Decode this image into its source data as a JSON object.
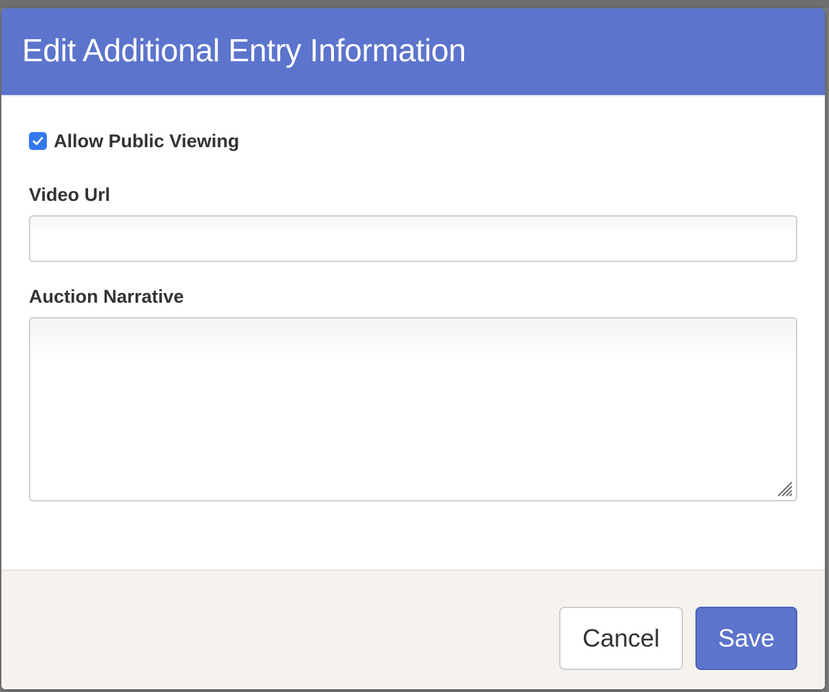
{
  "modal": {
    "title": "Edit Additional Entry Information",
    "accent_color": "#5c74cc"
  },
  "form": {
    "allow_public_viewing": {
      "label": "Allow Public Viewing",
      "checked": true,
      "checkbox_color": "#3478f0"
    },
    "video_url": {
      "label": "Video Url",
      "value": "",
      "placeholder": ""
    },
    "auction_narrative": {
      "label": "Auction Narrative",
      "value": "",
      "placeholder": ""
    }
  },
  "footer": {
    "cancel_label": "Cancel",
    "save_label": "Save"
  },
  "icons": {
    "checkbox": "check-icon",
    "resize": "resize-handle-icon"
  }
}
